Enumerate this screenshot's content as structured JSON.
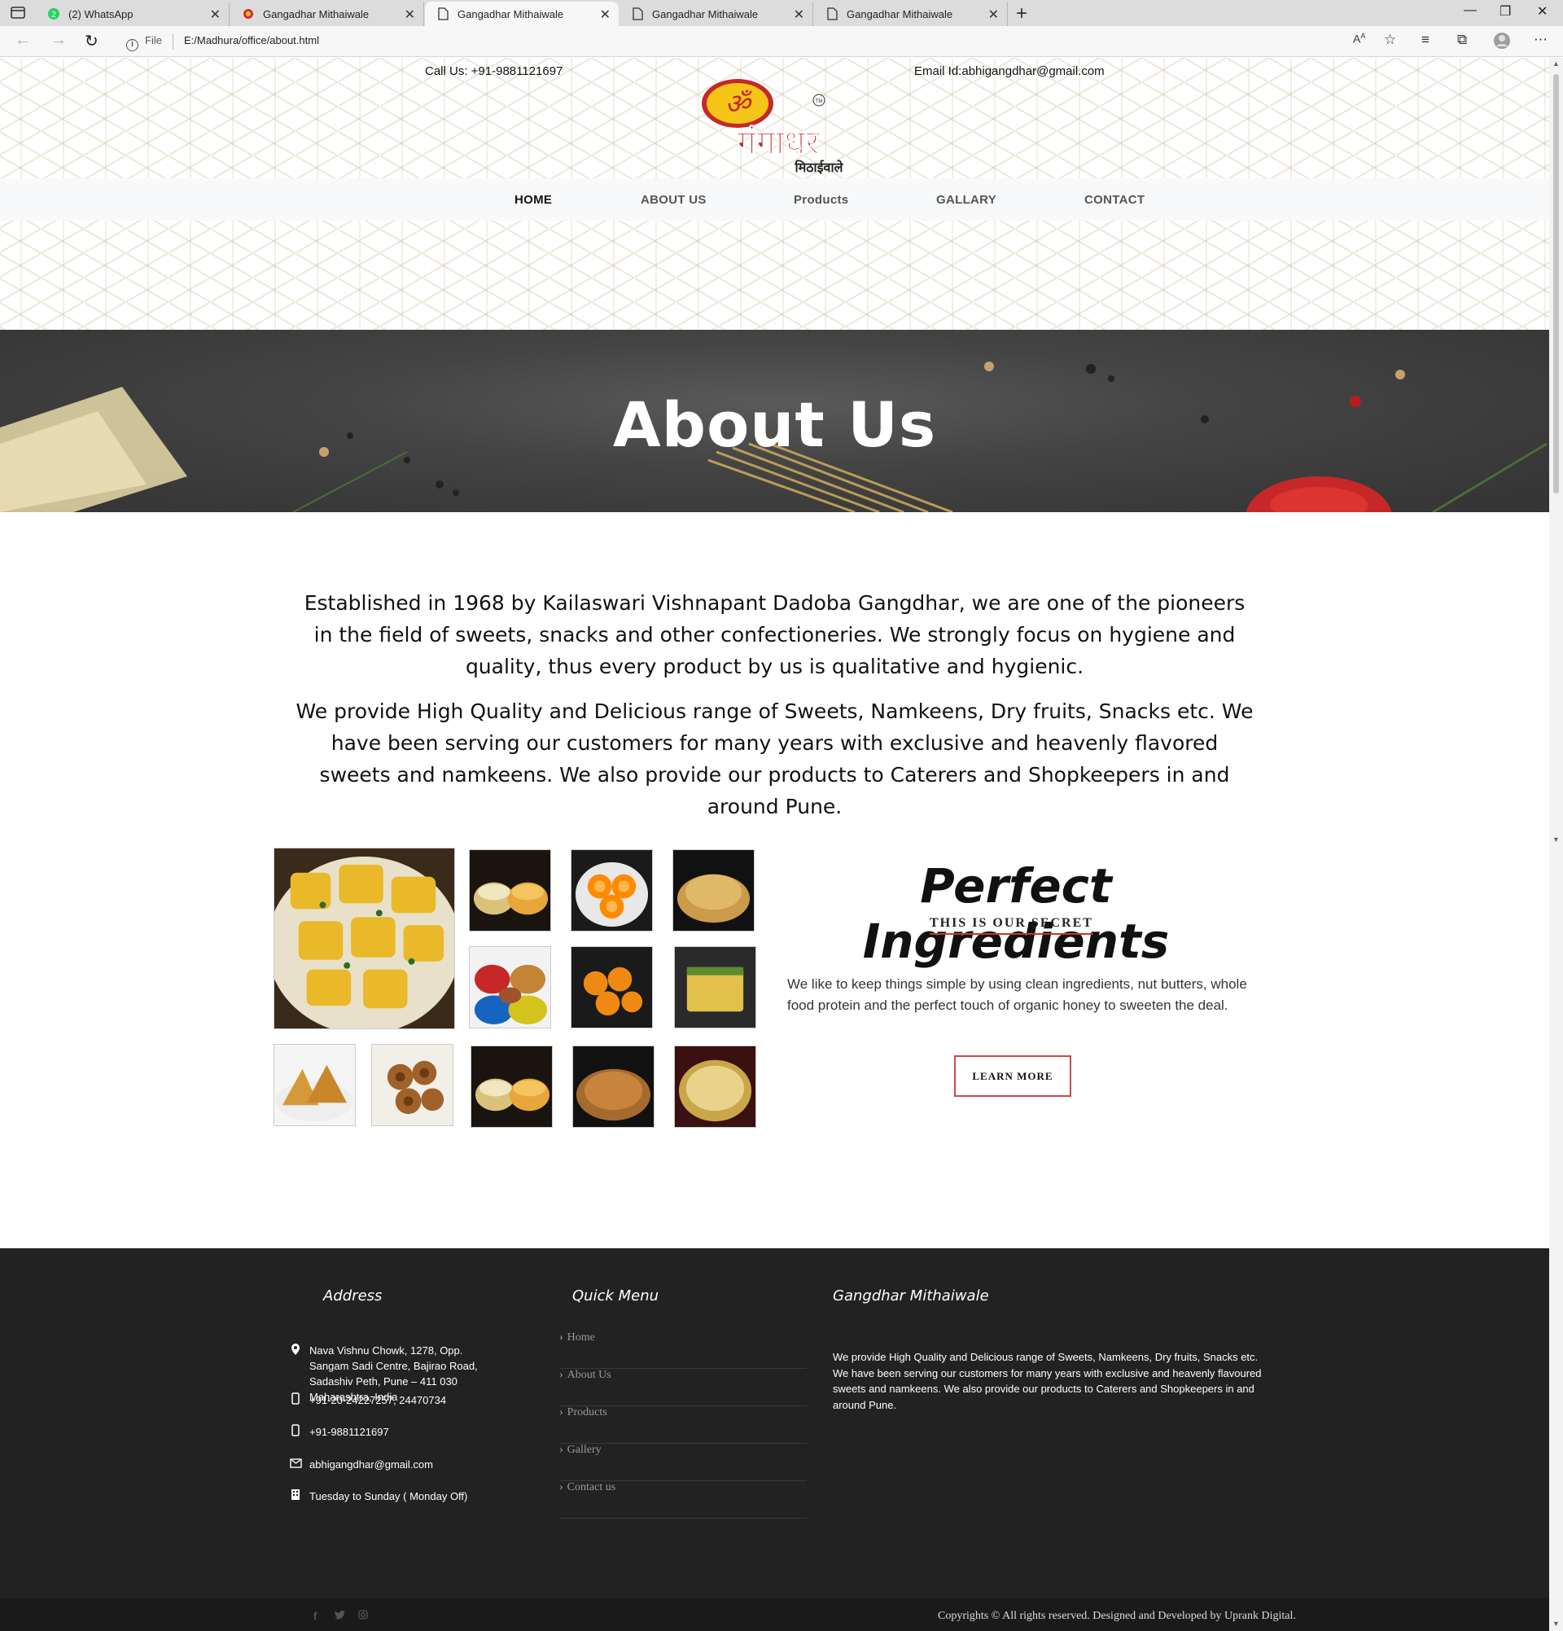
{
  "browser": {
    "tabs": [
      {
        "title": "(2) WhatsApp",
        "icon": "whatsapp-icon",
        "active": false
      },
      {
        "title": "Gangadhar Mithaiwale",
        "icon": "site-favicon",
        "active": false
      },
      {
        "title": "Gangadhar Mithaiwale",
        "icon": "page-icon",
        "active": true
      },
      {
        "title": "Gangadhar Mithaiwale",
        "icon": "page-icon",
        "active": false
      },
      {
        "title": "Gangadhar Mithaiwale",
        "icon": "page-icon",
        "active": false
      }
    ],
    "address": {
      "scheme_label": "File",
      "url": "E:/Madhura/office/about.html"
    }
  },
  "header": {
    "call": "Call Us: +91-9881121697",
    "email": "Email Id:abhigangdhar@gmail.com",
    "logo": {
      "om": "ॐ",
      "brand": "गंगाधर",
      "sub": "मिठाईवाले",
      "tm": "TM"
    },
    "nav": [
      "HOME",
      "ABOUT US",
      "Products",
      "GALLARY",
      "CONTACT"
    ]
  },
  "banner": {
    "title": "About Us"
  },
  "intro": {
    "p1": "Established in 1968 by Kailaswari Vishnapant Dadoba Gangdhar, we are one of the pioneers in the field of sweets, snacks and other confectioneries. We strongly focus on hygiene and quality, thus every product by us is qualitative and hygienic.",
    "p2": "We provide High Quality and Delicious range of Sweets, Namkeens, Dry fruits, Snacks etc. We have been serving our customers for many years with exclusive and heavenly flavored sweets and namkeens. We also provide our products to Caterers and Shopkeepers in and around Pune."
  },
  "ingredients": {
    "title": "Perfect Ingredients",
    "subtitle": "THIS IS OUR SECRET",
    "description": "We like to keep things simple by using clean ingredients, nut butters, whole food protein and the perfect touch of organic honey to sweeten the deal.",
    "button": "LEARN MORE"
  },
  "footer": {
    "address_heading": "Address",
    "address": "Nava Vishnu Chowk, 1278, Opp. Sangam Sadi Centre, Bajirao Road, Sadashiv Peth, Pune – 411 030 Maharashtra, India",
    "phone1": "+91-20-24227257, 24470734",
    "phone2": "+91-9881121697",
    "email": "abhigangdhar@gmail.com",
    "hours": "Tuesday to Sunday ( Monday Off)",
    "quick_heading": "Quick Menu",
    "quick": [
      "Home",
      "About Us",
      "Products",
      "Gallery",
      "Contact us"
    ],
    "brand_heading": "Gangdhar Mithaiwale",
    "brand_desc": "We provide High Quality and Delicious range of Sweets, Namkeens, Dry fruits, Snacks etc. We have been serving our customers for many years with exclusive and heavenly flavoured sweets and namkeens. We also provide our products to Caterers and Shopkeepers in and around Pune.",
    "copyright": "Copyrights © All rights reserved. Designed and Developed by Uprank Digital.",
    "social": [
      "facebook-icon",
      "twitter-icon",
      "instagram-icon"
    ]
  },
  "colors": {
    "accent": "#c0392b",
    "footer_bg": "#222222",
    "banner_bg": "#444444"
  }
}
